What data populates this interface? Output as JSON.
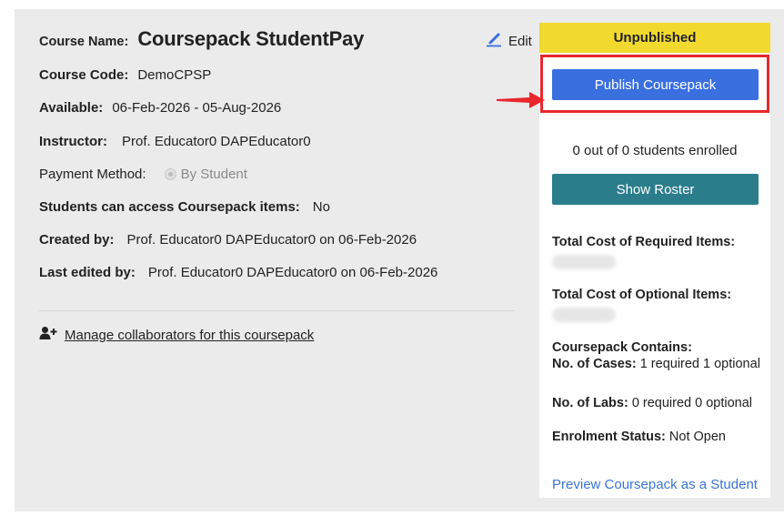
{
  "course": {
    "name_label": "Course Name:",
    "name": "Coursepack StudentPay",
    "edit_label": "Edit",
    "code_label": "Course Code:",
    "code": "DemoCPSP",
    "available_label": "Available:",
    "available": "06-Feb-2026 - 05-Aug-2026",
    "instructor_label": "Instructor:",
    "instructor": "Prof. Educator0 DAPEducator0",
    "payment_label": "Payment Method:",
    "payment": "By Student",
    "access_label": "Students can access Coursepack items:",
    "access": "No",
    "created_label": "Created by:",
    "created": "Prof. Educator0 DAPEducator0 on 06-Feb-2026",
    "edited_label": "Last edited by:",
    "edited": "Prof. Educator0 DAPEducator0 on 06-Feb-2026",
    "collaborators_link": "Manage collaborators for this coursepack"
  },
  "sidebar": {
    "status": "Unpublished",
    "publish_button": "Publish Coursepack",
    "enrolled": "0 out of 0 students enrolled",
    "roster_button": "Show Roster",
    "required_cost_label": "Total Cost of Required Items:",
    "optional_cost_label": "Total Cost of Optional Items:",
    "contains_label": "Coursepack Contains:",
    "cases_label": "No. of Cases:",
    "cases_value": "1 required 1 optional",
    "labs_label": "No. of Labs:",
    "labs_value": "0 required 0 optional",
    "enrolment_label": "Enrolment Status:",
    "enrolment_value": "Not Open",
    "preview_link": "Preview Coursepack as a Student"
  },
  "colors": {
    "status_bg": "#f2d92e",
    "publish_button": "#3a6fe0",
    "roster_button": "#2b7d8c",
    "highlight": "#e8272d",
    "link": "#3a74d6"
  },
  "icons": [
    "pencil-icon",
    "add-user-icon",
    "arrow-icon"
  ]
}
